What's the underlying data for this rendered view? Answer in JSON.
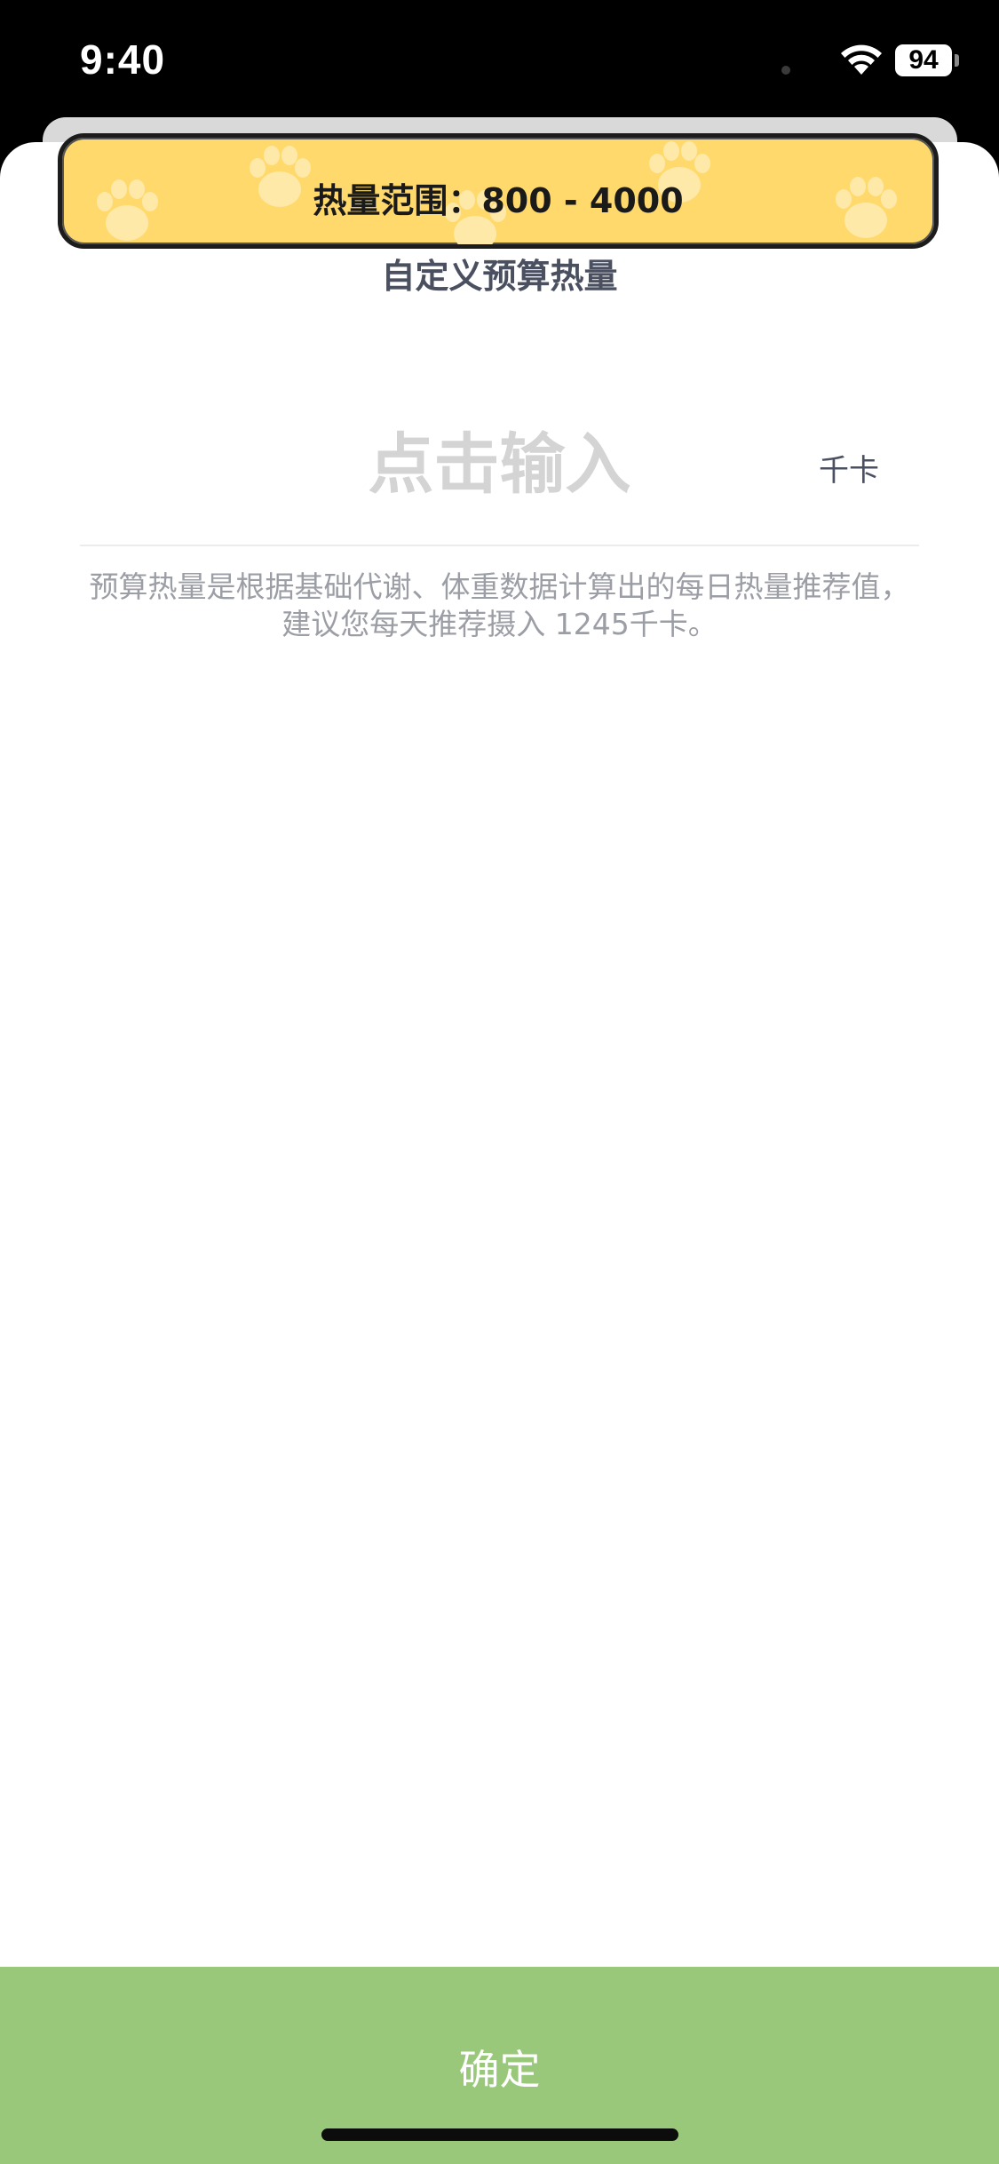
{
  "status_bar": {
    "time": "9:40",
    "battery_level": "94",
    "wifi_icon": "wifi-icon",
    "battery_icon": "battery-icon"
  },
  "toast": {
    "text": "热量范围：800 - 4000",
    "background_color": "#ffd96b",
    "decoration_icon": "paw-icon"
  },
  "page": {
    "title": "自定义预算热量"
  },
  "input": {
    "placeholder": "点击输入",
    "value": "",
    "unit": "千卡"
  },
  "hint": {
    "text": "预算热量是根据基础代谢、体重数据计算出的每日热量推荐值，建议您每天推荐摄入  1245千卡。"
  },
  "confirm": {
    "label": "确定",
    "color": "#9ac87b"
  }
}
